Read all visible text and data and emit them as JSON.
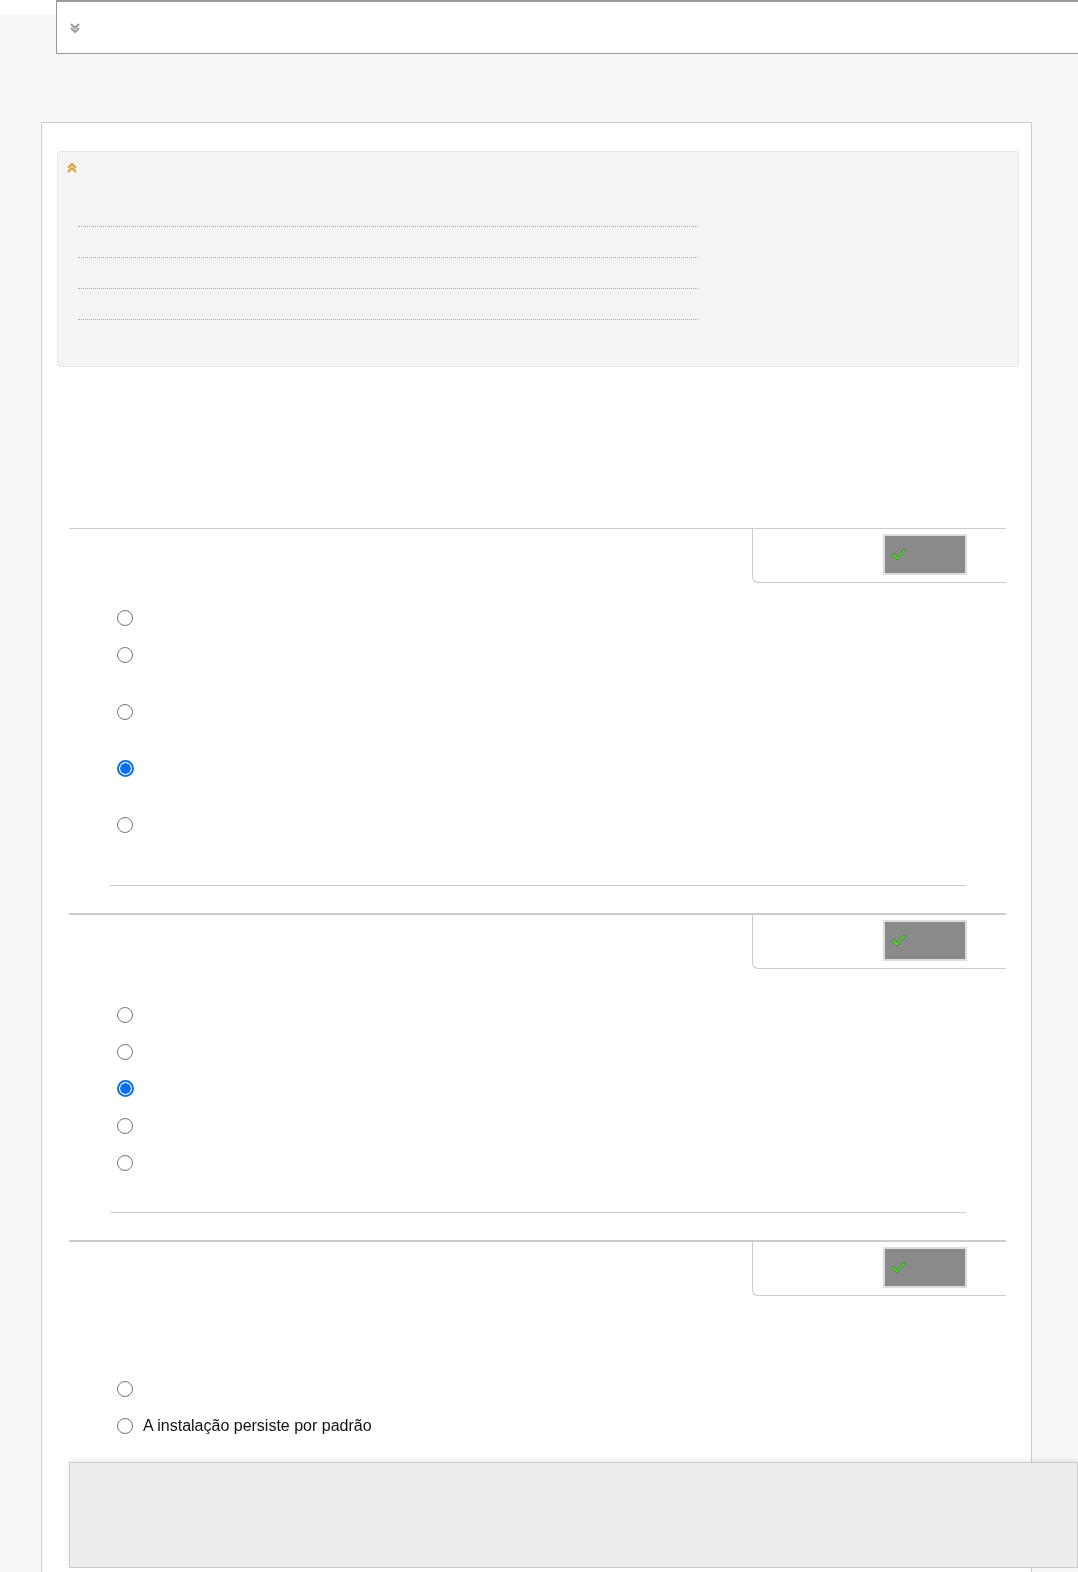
{
  "top_bar": {
    "collapsed": true
  },
  "info_panel": {
    "expanded": true
  },
  "questions": [
    {
      "options": [
        {
          "selected": false
        },
        {
          "selected": false
        },
        {
          "selected": false
        },
        {
          "selected": true
        },
        {
          "selected": false
        }
      ]
    },
    {
      "options": [
        {
          "selected": false
        },
        {
          "selected": false
        },
        {
          "selected": true
        },
        {
          "selected": false
        },
        {
          "selected": false
        }
      ]
    },
    {
      "options": [
        {
          "selected": false
        },
        {
          "selected": false,
          "label": "A instalação persiste por padrão"
        }
      ]
    }
  ]
}
